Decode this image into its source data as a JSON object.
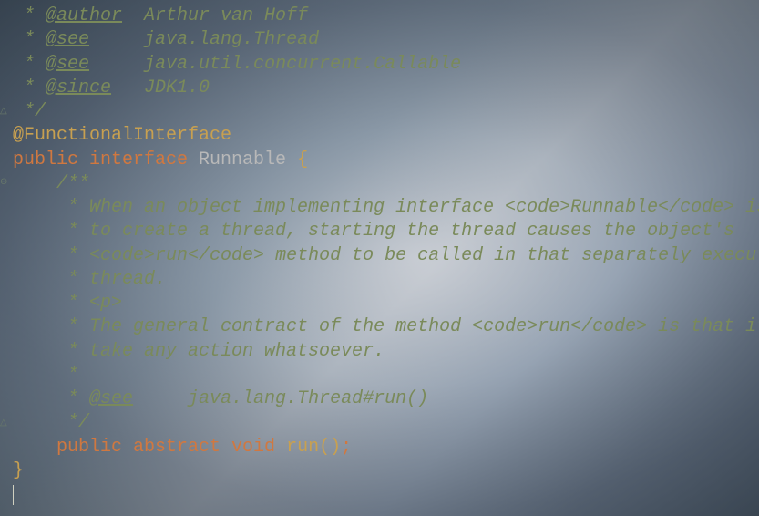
{
  "gutter": {
    "icon1": "△",
    "icon2": "⊖",
    "icon3": "△"
  },
  "code": {
    "l1_star": " * ",
    "l1_tag": "@author",
    "l1_text": "  Arthur van Hoff",
    "l2_star": " * ",
    "l2_tag": "@see",
    "l2_text": "     java.lang.Thread",
    "l3_star": " * ",
    "l3_tag": "@see",
    "l3_text": "     java.util.concurrent.Callable",
    "l4_star": " * ",
    "l4_tag": "@since",
    "l4_text": "   JDK1.0",
    "l5": " */",
    "l6": "@FunctionalInterface",
    "l7_kw1": "public ",
    "l7_kw2": "interface ",
    "l7_type": "Runnable ",
    "l7_brace": "{",
    "l8": "    /**",
    "l9_a": "     * When an object implementing interface ",
    "l9_b": "<code>",
    "l9_c": "Runnable",
    "l9_d": "</code>",
    "l9_e": " is used",
    "l10": "     * to create a thread, starting the thread causes the object's",
    "l11_a": "     * ",
    "l11_b": "<code>",
    "l11_c": "run",
    "l11_d": "</code>",
    "l11_e": " method to be called in that separately executing",
    "l12": "     * thread.",
    "l13_a": "     * ",
    "l13_b": "<p>",
    "l14_a": "     * The general contract of the method ",
    "l14_b": "<code>",
    "l14_c": "run",
    "l14_d": "</code>",
    "l14_e": " is that it may",
    "l15": "     * take any action whatsoever.",
    "l16": "     *",
    "l17_a": "     * ",
    "l17_tag": "@see",
    "l17_b": "     java.lang.Thread",
    "l17_c": "#run()",
    "l18": "     */",
    "l19_kw": "    public abstract void ",
    "l19_m": "run",
    "l19_p": "()",
    "l19_s": ";",
    "l20": "}"
  }
}
